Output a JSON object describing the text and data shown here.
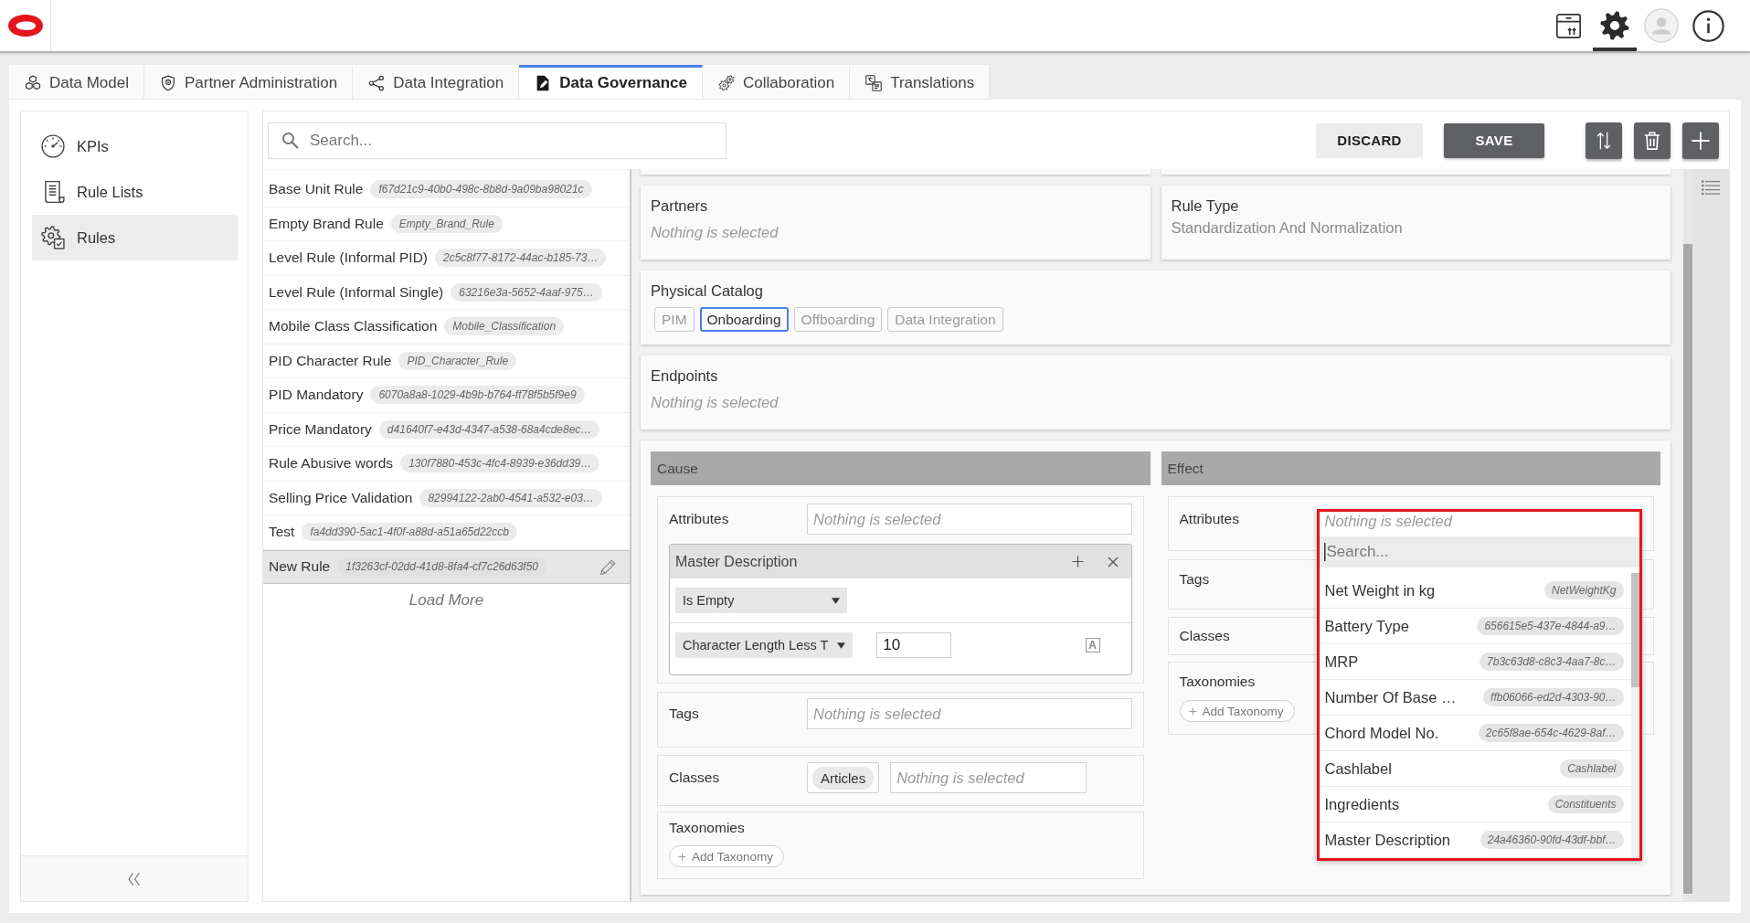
{
  "header": {
    "icons": [
      {
        "selected": false
      },
      {
        "selected": true
      },
      {
        "selected": false
      },
      {
        "selected": false
      }
    ]
  },
  "tabs": [
    {
      "label": "Data Model",
      "selected": false
    },
    {
      "label": "Partner Administration",
      "selected": false
    },
    {
      "label": "Data Integration",
      "selected": false
    },
    {
      "label": "Data Governance",
      "selected": true
    },
    {
      "label": "Collaboration",
      "selected": false
    },
    {
      "label": "Translations",
      "selected": false
    }
  ],
  "side_nav": {
    "items": [
      {
        "label": "KPIs",
        "selected": false
      },
      {
        "label": "Rule Lists",
        "selected": false
      },
      {
        "label": "Rules",
        "selected": true
      }
    ]
  },
  "toolbar": {
    "search": {
      "placeholder": "Search..."
    },
    "buttons": [
      {
        "label": "DISCARD",
        "kind": "secondary"
      },
      {
        "label": "SAVE",
        "kind": "primary"
      }
    ]
  },
  "rules": {
    "items": [
      {
        "name": "Base Unit Rule",
        "code": "f67d21c9-40b0-498c-8b8d-9a09ba98021c",
        "selected": false
      },
      {
        "name": "Empty Brand Rule",
        "code": "Empty_Brand_Rule",
        "selected": false
      },
      {
        "name": "Level Rule (Informal PID)",
        "code": "2c5c8f77-8172-44ac-b185-73…",
        "selected": false
      },
      {
        "name": "Level Rule (Informal Single)",
        "code": "63216e3a-5652-4aaf-975…",
        "selected": false
      },
      {
        "name": "Mobile Class Classification",
        "code": "Mobile_Classification",
        "selected": false
      },
      {
        "name": "PID Character Rule",
        "code": "PID_Character_Rule",
        "selected": false
      },
      {
        "name": "PID Mandatory",
        "code": "6070a8a8-1029-4b9b-b764-ff78f5b5f9e9",
        "selected": false
      },
      {
        "name": "Price Mandatory",
        "code": "d41640f7-e43d-4347-a538-68a4cde8ec…",
        "selected": false
      },
      {
        "name": "Rule Abusive words",
        "code": "130f7880-453c-4fc4-8939-e36dd39…",
        "selected": false
      },
      {
        "name": "Selling Price Validation",
        "code": "82994122-2ab0-4541-a532-e03…",
        "selected": false
      },
      {
        "name": "Test",
        "code": "fa4dd390-5ac1-4f0f-a88d-a51a65d22ccb",
        "selected": false
      },
      {
        "name": "New Rule",
        "code": "1f3263cf-02dd-41d8-8fa4-cf7c26d63f50",
        "selected": true
      }
    ],
    "load_more": "Load More"
  },
  "details": {
    "partners": {
      "label": "Partners",
      "placeholder": "Nothing is selected"
    },
    "rule_type": {
      "label": "Rule Type",
      "value": "Standardization And Normalization"
    },
    "physical_catalog": {
      "label": "Physical Catalog",
      "options": [
        {
          "label": "PIM",
          "selected": false
        },
        {
          "label": "Onboarding",
          "selected": true
        },
        {
          "label": "Offboarding",
          "selected": false
        },
        {
          "label": "Data Integration",
          "selected": false
        }
      ]
    },
    "endpoints": {
      "label": "Endpoints",
      "placeholder": "Nothing is selected"
    }
  },
  "cause": {
    "title": "Cause",
    "attributes": {
      "label": "Attributes",
      "placeholder": "Nothing is selected"
    },
    "conditions": [
      {
        "attribute": "Master Description",
        "rows": [
          {
            "operator": "Is Empty"
          },
          {
            "operator": "Character Length Less T",
            "value": "10",
            "case_toggle": "A"
          }
        ]
      }
    ],
    "tags": {
      "label": "Tags",
      "placeholder": "Nothing is selected"
    },
    "classes": {
      "label": "Classes",
      "chips": [
        "Articles"
      ],
      "placeholder": "Nothing is selected"
    },
    "taxonomies": {
      "label": "Taxonomies",
      "button": "Add Taxonomy"
    }
  },
  "effect": {
    "title": "Effect",
    "attributes": {
      "label": "Attributes",
      "dropdown": {
        "highlighted": true,
        "placeholder": "Nothing is selected",
        "search_placeholder": "Search...",
        "options": [
          {
            "label": "Net Weight in kg",
            "code": "NetWeightKg"
          },
          {
            "label": "Battery Type",
            "code": "656615e5-437e-4844-a9…"
          },
          {
            "label": "MRP",
            "code": "7b3c63d8-c8c3-4aa7-8c…"
          },
          {
            "label": "Number Of Base …",
            "code": "ffb06066-ed2d-4303-90…"
          },
          {
            "label": "Chord Model No.",
            "code": "2c65f8ae-654c-4629-8af…"
          },
          {
            "label": "Cashlabel",
            "code": "Cashlabel"
          },
          {
            "label": "Ingredients",
            "code": "Constituents"
          },
          {
            "label": "Master Description",
            "code": "24a46360-90fd-43df-bbf…"
          }
        ]
      }
    },
    "tags": {
      "label": "Tags"
    },
    "classes": {
      "label": "Classes"
    },
    "taxonomies": {
      "label": "Taxonomies",
      "button": "Add Taxonomy"
    }
  }
}
